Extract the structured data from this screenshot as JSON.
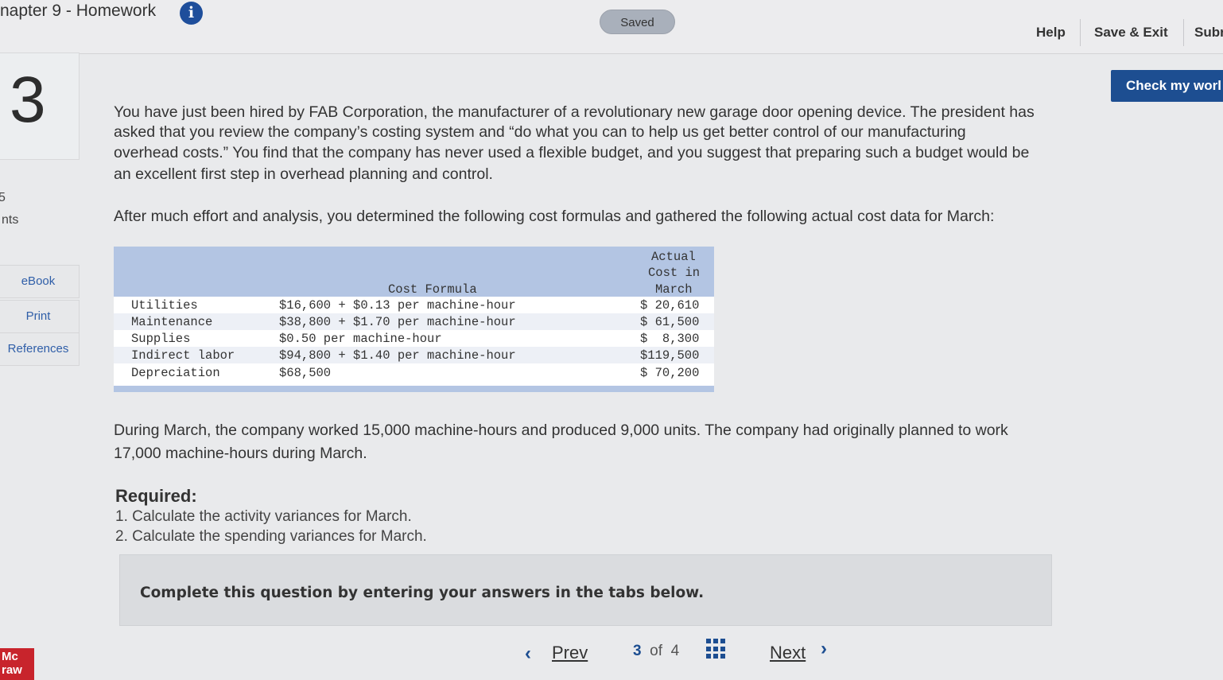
{
  "header": {
    "assignment_title": "napter 9 - Homework",
    "saved_label": "Saved",
    "help_label": "Help",
    "save_exit_label": "Save & Exit",
    "submit_label": "Subr"
  },
  "sidebar": {
    "question_number": "3",
    "points_value": "5",
    "points_label": "nts",
    "buttons": [
      "eBook",
      "Print",
      "References"
    ],
    "logo_text": [
      "Mc",
      "raw"
    ]
  },
  "check_button_label": "Check my worl",
  "problem": {
    "intro_lines": [
      "You have just been hired by FAB Corporation, the manufacturer of a revolutionary new garage door opening device. The president has",
      "asked that you review the company’s costing system and “do what you can to help us get better control of our manufacturing",
      "overhead costs.” You find that the company has never used a flexible budget, and you suggest that preparing such a budget would be",
      "an excellent first step in overhead planning and control."
    ],
    "lead_in": "After much effort and analysis, you determined the following cost formulas and gathered the following actual cost data for March:",
    "table": {
      "col_formula": "Cost Formula",
      "col_actual": [
        "Actual",
        "Cost in",
        "March"
      ],
      "rows": [
        {
          "item": "Utilities",
          "formula": "$16,600 + $0.13 per machine-hour",
          "actual": "$ 20,610"
        },
        {
          "item": "Maintenance",
          "formula": "$38,800 + $1.70 per machine-hour",
          "actual": "$ 61,500"
        },
        {
          "item": "Supplies",
          "formula": "$0.50 per machine-hour",
          "actual": "$  8,300"
        },
        {
          "item": "Indirect labor",
          "formula": "$94,800 + $1.40 per machine-hour",
          "actual": "$119,500"
        },
        {
          "item": "Depreciation",
          "formula": "$68,500",
          "actual": "$ 70,200"
        }
      ]
    },
    "during_lines": [
      "During March, the company worked 15,000 machine-hours and produced 9,000 units. The company had originally planned to work",
      "17,000 machine-hours during March."
    ],
    "required_title": "Required:",
    "required_items": [
      "1. Calculate the activity variances for March.",
      "2. Calculate the spending variances for March."
    ],
    "instruction": "Complete this question by entering your answers in the tabs below."
  },
  "nav": {
    "prev_label": "Prev",
    "current_page": "3",
    "of_label": "of",
    "total_pages": "4",
    "next_label": "Next"
  }
}
